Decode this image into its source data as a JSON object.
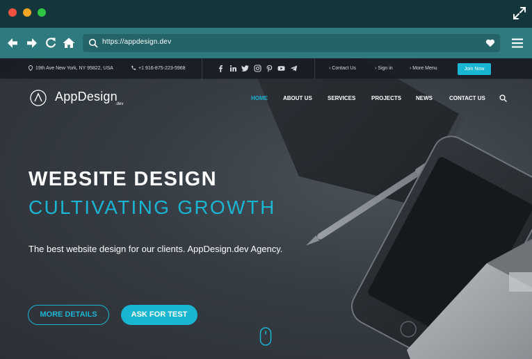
{
  "browser": {
    "url": "https://appdesign.dev"
  },
  "icons": {
    "window_controls": [
      "close-dot",
      "minimize-dot",
      "maximize-dot"
    ],
    "expand": "expand-icon",
    "nav": [
      "back-arrow-icon",
      "forward-arrow-icon",
      "reload-icon",
      "home-icon"
    ],
    "url_search": "search-icon",
    "bookmark": "heart-icon",
    "menu": "hamburger-menu-icon"
  },
  "topbar": {
    "address": "19th Ave New York, NY 95822, USA",
    "phone": "+1 916-875-223-5968",
    "social": [
      "facebook-icon",
      "linkedin-icon",
      "twitter-icon",
      "instagram-icon",
      "pinterest-icon",
      "youtube-icon",
      "telegram-icon"
    ],
    "links": {
      "contact": "Contact Us",
      "signin": "Sign in",
      "more": "More Menu"
    },
    "join": "Join Now"
  },
  "brand": {
    "name": "AppDesign",
    "suffix": ".dev"
  },
  "nav": {
    "home": "HOME",
    "about": "ABOUT US",
    "services": "SERVICES",
    "projects": "PROJECTS",
    "news": "NEWS",
    "contact": "CONTACT US",
    "active": "HOME"
  },
  "hero": {
    "title": "WEBSITE DESIGN",
    "subtitle": "CULTIVATING GROWTH",
    "lead": "The best website design for our clients. AppDesign.dev Agency.",
    "btn_details": "MORE DETAILS",
    "btn_test": "ASK FOR TEST"
  },
  "colors": {
    "accent": "#1ab5d3",
    "titlebar": "#13363a",
    "toolbar": "#2f7a7f",
    "topbar": "#161a22"
  }
}
